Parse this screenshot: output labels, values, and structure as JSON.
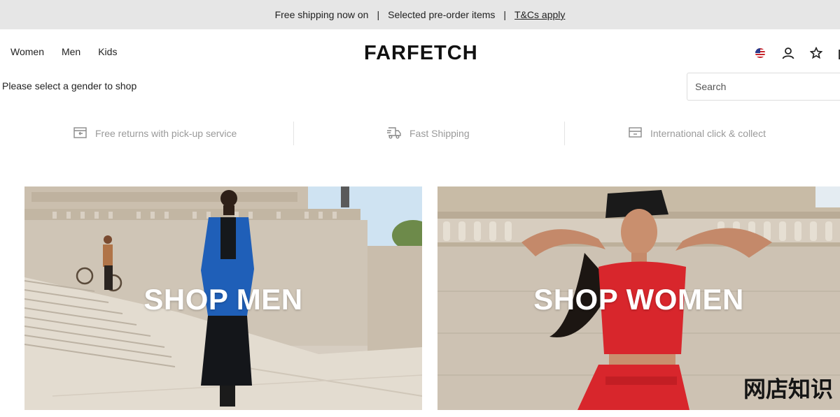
{
  "promo": {
    "text1": "Free shipping now on",
    "separator": "|",
    "text2": "Selected pre-order items",
    "link": "T&Cs apply"
  },
  "nav": {
    "items": [
      {
        "label": "Women"
      },
      {
        "label": "Men"
      },
      {
        "label": "Kids"
      }
    ]
  },
  "header": {
    "logo": "FARFETCH",
    "icons": [
      "us-flag-icon",
      "account-icon",
      "wishlist-star-icon",
      "bag-icon"
    ]
  },
  "gender_prompt": "Please select a gender to shop",
  "search": {
    "placeholder": "Search"
  },
  "services": [
    {
      "label": "Free returns with pick-up service",
      "icon": "returns-box-icon"
    },
    {
      "label": "Fast Shipping",
      "icon": "delivery-truck-icon"
    },
    {
      "label": "International click & collect",
      "icon": "store-icon"
    }
  ],
  "banners": {
    "men": {
      "title": "SHOP MEN"
    },
    "women": {
      "title": "SHOP WOMEN"
    }
  },
  "watermark": "网店知识",
  "colors": {
    "promo_bg": "#e6e6e6",
    "service_text": "#9a9a9a",
    "accent_red": "#d8262c",
    "coat_blue": "#1f5fb8"
  }
}
